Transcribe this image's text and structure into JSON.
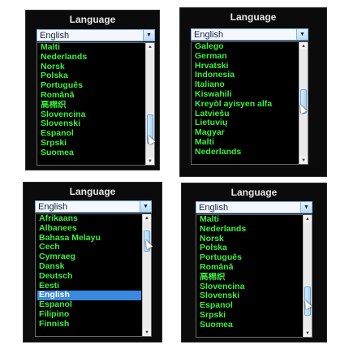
{
  "panels": [
    {
      "title": "Language",
      "selected": "English",
      "items": [
        "Malti",
        "Nederlands",
        "Norsk",
        "Polska",
        "Português",
        "Română",
        "高棉织",
        "Slovencina",
        "Slovenski",
        "Espanol",
        "Srpski",
        "Suomea"
      ],
      "highlight_index": -1
    },
    {
      "title": "Language",
      "selected": "English",
      "items": [
        "Galego",
        "German",
        "Hrvatski",
        "Indonesia",
        "Italiano",
        "Kiswahili",
        "Kreyòl ayisyen alfa",
        "Latviešu",
        "Lietuvių",
        "Magyar",
        "Malti",
        "Nederlands"
      ],
      "highlight_index": -1
    },
    {
      "title": "Language",
      "selected": "English",
      "items": [
        "Afrikaans",
        "Albanees",
        "Bahasa Melayu",
        "Cech",
        "Cymraeg",
        "Dansk",
        "Deutsch",
        "Eesti",
        "English",
        "Espanol",
        "Filipino",
        "Finnish"
      ],
      "highlight_index": 8
    },
    {
      "title": "Language",
      "selected": "English",
      "items": [
        "Malti",
        "Nederlands",
        "Norsk",
        "Polska",
        "Português",
        "Română",
        "高棉织",
        "Slovencina",
        "Slovenski",
        "Espanol",
        "Srpski",
        "Suomea"
      ],
      "highlight_index": -1
    }
  ],
  "icons": {
    "dropdown_arrow": "▼",
    "scroll_up": "▲",
    "scroll_down": "▼"
  },
  "colors": {
    "item_text": "#3cf03c",
    "highlight": "#3a88e0",
    "dropdown_border": "#7ab2e0"
  }
}
